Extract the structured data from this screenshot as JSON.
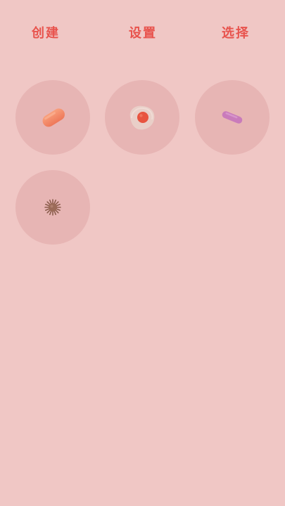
{
  "toolbar": {
    "create_label": "创建",
    "settings_label": "设置",
    "select_label": "选择"
  },
  "cells": [
    {
      "icon": "orange-capsule-icon",
      "color": "#f3896a"
    },
    {
      "icon": "fried-egg-icon",
      "color": "#e8543f"
    },
    {
      "icon": "purple-capsule-icon",
      "color": "#c97bbb"
    },
    {
      "icon": "spiky-ball-icon",
      "color": "#8a5d4c"
    }
  ],
  "colors": {
    "background": "#f0c7c5",
    "tile": "#e7b5b4",
    "accent": "#e8534d"
  }
}
